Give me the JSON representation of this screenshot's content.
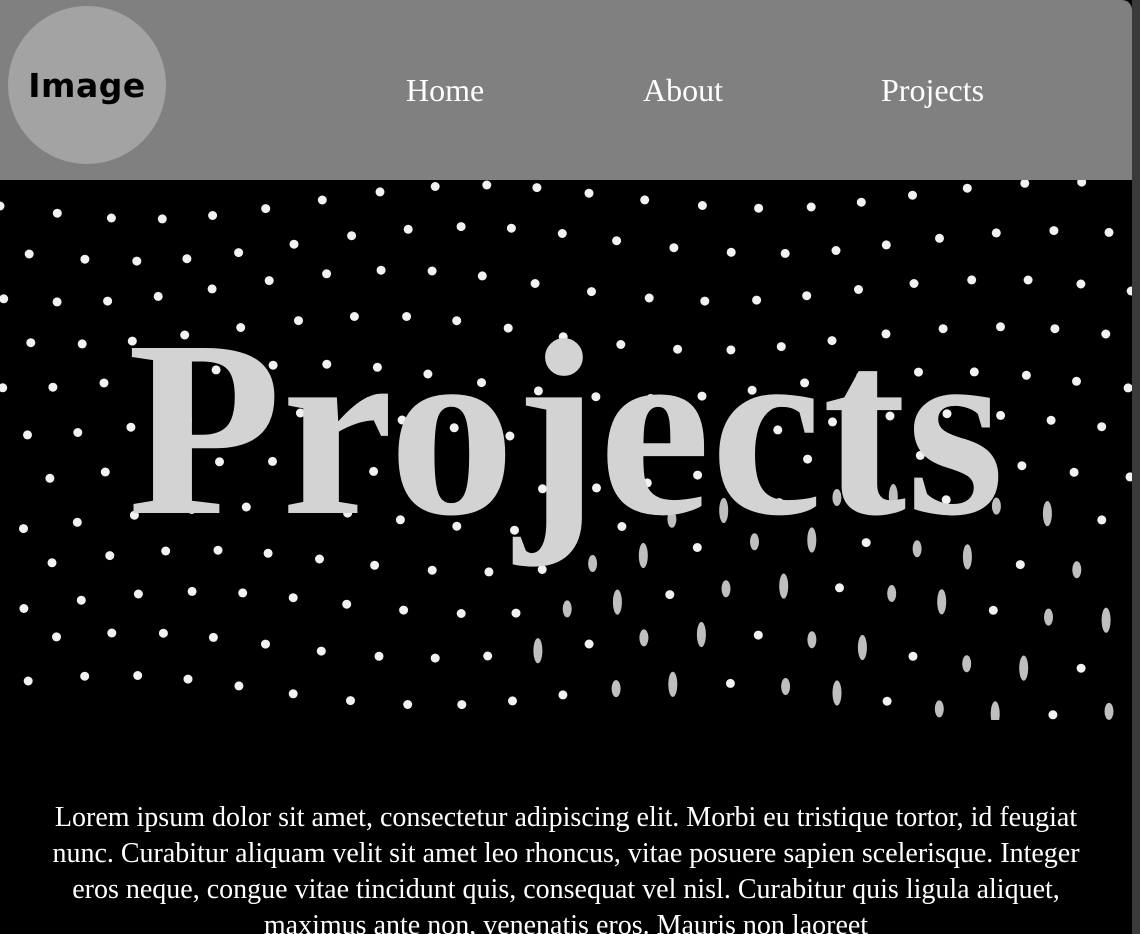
{
  "header": {
    "logo_text": "Image",
    "nav": [
      {
        "label": "Home"
      },
      {
        "label": "About"
      },
      {
        "label": "Projects"
      }
    ]
  },
  "hero": {
    "title": "Projects"
  },
  "content": {
    "paragraph": "Lorem ipsum dolor sit amet, consectetur adipiscing elit. Morbi eu tristique tortor, id feugiat nunc. Curabitur aliquam velit sit amet leo rhoncus, vitae posuere sapien scelerisque. Integer eros neque, congue vitae tincidunt quis, consequat vel nisl. Curabitur quis ligula aliquet, maximus ante non, venenatis eros. Mauris non laoreet"
  },
  "colors": {
    "header_bg": "#808080",
    "logo_bg": "#a3a3a3",
    "page_bg": "#000000",
    "hero_title": "#d3d3d3",
    "nav_text": "#ffffff"
  }
}
